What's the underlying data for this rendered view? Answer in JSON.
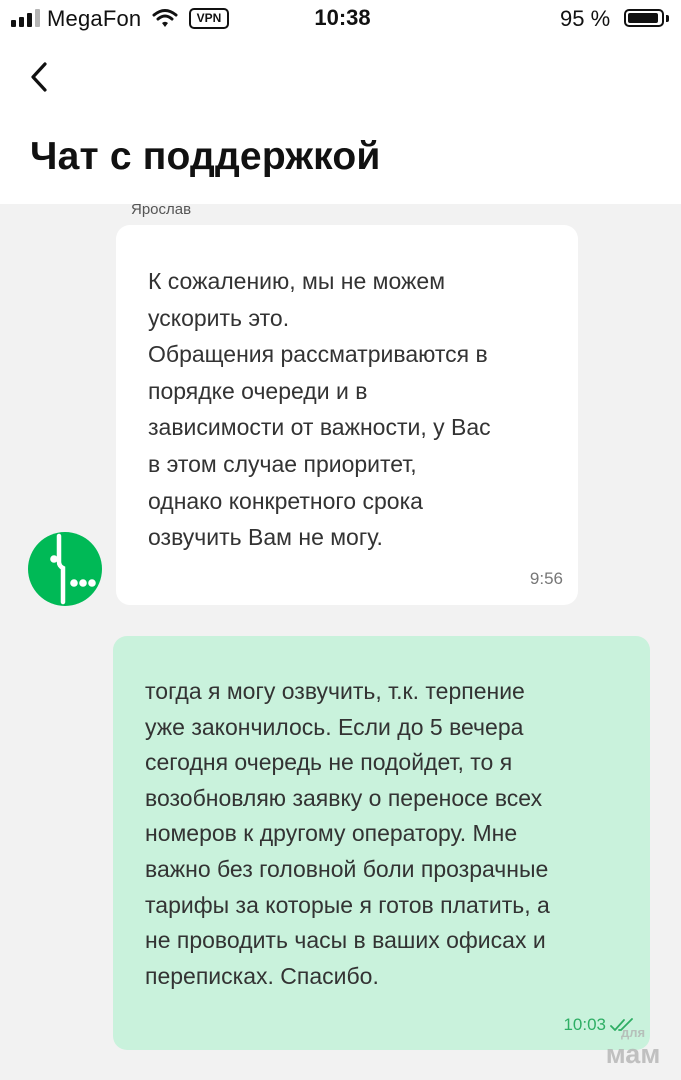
{
  "status_bar": {
    "carrier": "MegaFon",
    "vpn_label": "VPN",
    "time": "10:38",
    "battery_percent": "95 %",
    "battery_level": 0.95,
    "signal_bars_active": 3,
    "signal_bars_total": 4
  },
  "header": {
    "title": "Чат с поддержкой"
  },
  "messages": [
    {
      "sender": "Ярослав",
      "avatar_icon": "megafon-logo-icon",
      "direction": "incoming",
      "lines": [
        "К сожалению, мы не можем",
        "ускорить это.",
        "Обращения рассматриваются в",
        "порядке очереди и в",
        "зависимости от важности, у Вас",
        "в этом случае приоритет,",
        "однако конкретного срока",
        "озвучить Вам не могу."
      ],
      "time": "9:56"
    },
    {
      "direction": "outgoing",
      "lines": [
        "тогда я могу озвучить, т.к. терпение",
        "уже закончилось. Если до 5 вечера",
        "сегодня очередь не подойдет, то я",
        "возобновляю заявку о переносе всех",
        "номеров к другому оператору. Мне",
        "важно без головной боли прозрачные",
        "тарифы за которые я готов платить, а",
        "не проводить часы в ваших офисах и",
        "переписках. Спасибо."
      ],
      "time": "10:03",
      "status_icon": "double-check-icon"
    }
  ],
  "watermark": {
    "line1": "для",
    "line2": "мам"
  },
  "colors": {
    "brand_green": "#00b956",
    "outgoing_bubble": "#c9f2dc",
    "incoming_bubble": "#ffffff",
    "chat_background": "#f2f2f2"
  }
}
